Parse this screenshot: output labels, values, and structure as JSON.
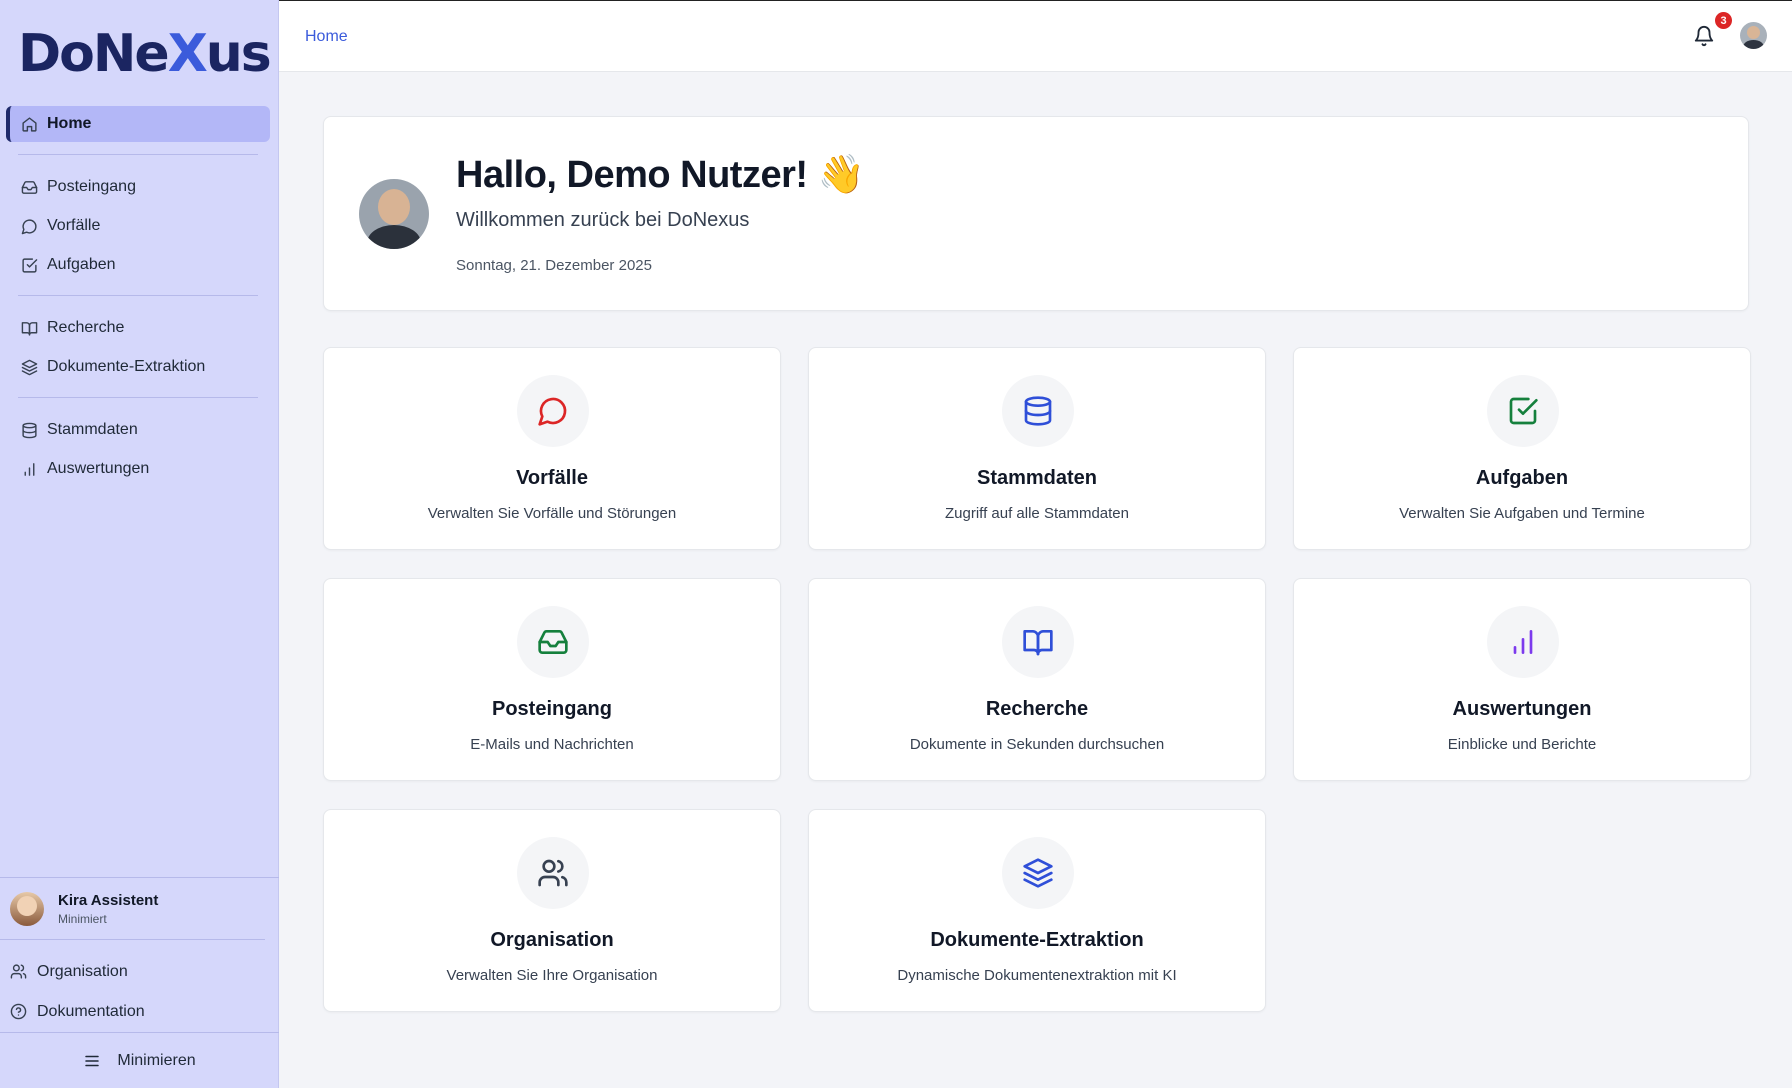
{
  "brand": {
    "logo_prefix": "DoNe",
    "logo_x": "X",
    "logo_suffix": "us"
  },
  "sidebar": {
    "groups": [
      [
        {
          "label": "Home",
          "icon": "home-icon",
          "active": true
        }
      ],
      [
        {
          "label": "Posteingang",
          "icon": "inbox-icon"
        },
        {
          "label": "Vorfälle",
          "icon": "message-circle-icon"
        },
        {
          "label": "Aufgaben",
          "icon": "check-square-icon"
        }
      ],
      [
        {
          "label": "Recherche",
          "icon": "book-open-icon"
        },
        {
          "label": "Dokumente-Extraktion",
          "icon": "layers-icon"
        }
      ],
      [
        {
          "label": "Stammdaten",
          "icon": "database-icon"
        },
        {
          "label": "Auswertungen",
          "icon": "bar-chart-icon"
        }
      ]
    ],
    "assistant": {
      "name": "Kira Assistent",
      "status": "Minimiert"
    },
    "bottom_links": [
      {
        "label": "Organisation",
        "icon": "users-icon"
      },
      {
        "label": "Dokumentation",
        "icon": "help-circle-icon"
      }
    ],
    "minimize_label": "Minimieren"
  },
  "topbar": {
    "breadcrumb": "Home",
    "notification_count": "3"
  },
  "welcome": {
    "title": "Hallo, Demo Nutzer! 👋",
    "subtitle": "Willkommen zurück bei DoNexus",
    "date": "Sonntag, 21. Dezember 2025"
  },
  "tiles": [
    {
      "title": "Vorfälle",
      "desc": "Verwalten Sie Vorfälle und Störungen",
      "icon": "message-circle-icon",
      "color": "#dc2626"
    },
    {
      "title": "Stammdaten",
      "desc": "Zugriff auf alle Stammdaten",
      "icon": "database-icon",
      "color": "#2f4fd8"
    },
    {
      "title": "Aufgaben",
      "desc": "Verwalten Sie Aufgaben und Termine",
      "icon": "check-square-icon",
      "color": "#15803d"
    },
    {
      "title": "Posteingang",
      "desc": "E-Mails und Nachrichten",
      "icon": "inbox-icon",
      "color": "#15803d"
    },
    {
      "title": "Recherche",
      "desc": "Dokumente in Sekunden durchsuchen",
      "icon": "book-open-icon",
      "color": "#2f4fd8"
    },
    {
      "title": "Auswertungen",
      "desc": "Einblicke und Berichte",
      "icon": "bar-chart-icon",
      "color": "#7c3aed"
    },
    {
      "title": "Organisation",
      "desc": "Verwalten Sie Ihre Organisation",
      "icon": "users-icon",
      "color": "#374151"
    },
    {
      "title": "Dokumente-Extraktion",
      "desc": "Dynamische Dokumentenextraktion mit KI",
      "icon": "layers-icon",
      "color": "#2f4fd8"
    }
  ]
}
